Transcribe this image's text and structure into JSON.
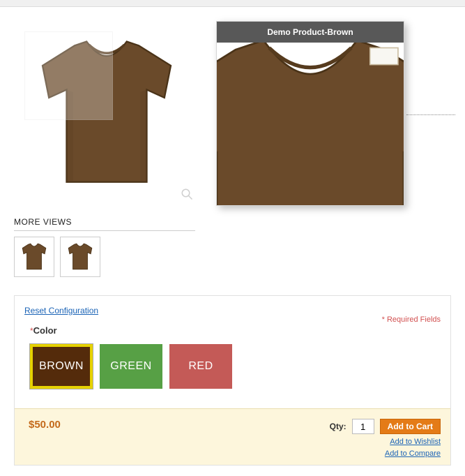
{
  "zoom_title": "Demo Product-Brown",
  "more_views_label": "MORE VIEWS",
  "reset_config_label": "Reset Configuration",
  "required_fields_label": "* Required Fields",
  "color_field": {
    "label": "Color",
    "asterisk": "*"
  },
  "swatches": [
    {
      "label": "BROWN",
      "selected": true
    },
    {
      "label": "GREEN",
      "selected": false
    },
    {
      "label": "RED",
      "selected": false
    }
  ],
  "price": "$50.00",
  "qty": {
    "label": "Qty:",
    "value": "1"
  },
  "add_to_cart_label": "Add to Cart",
  "wishlist_label": "Add to Wishlist",
  "compare_label": "Add to Compare",
  "colors": {
    "tshirt_fill": "#6a4a2a",
    "tshirt_stroke": "#4a3318",
    "tshirt_shadow": "#563b1e"
  }
}
